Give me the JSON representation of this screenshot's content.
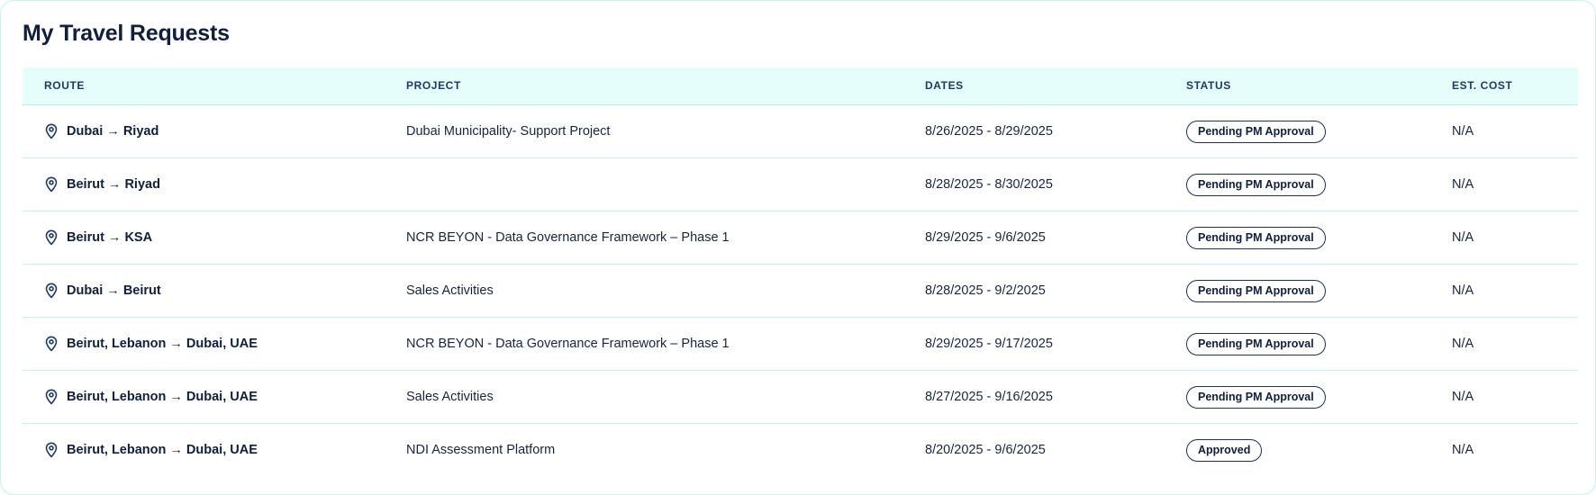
{
  "page": {
    "title": "My Travel Requests"
  },
  "table": {
    "headers": {
      "route": "ROUTE",
      "project": "PROJECT",
      "dates": "DATES",
      "status": "STATUS",
      "cost": "EST. COST"
    },
    "rows": [
      {
        "route": "Dubai → Riyad",
        "project": "Dubai Municipality- Support Project",
        "dates": "8/26/2025 - 8/29/2025",
        "status": "Pending PM Approval",
        "cost": "N/A"
      },
      {
        "route": "Beirut → Riyad",
        "project": "",
        "dates": "8/28/2025 - 8/30/2025",
        "status": "Pending PM Approval",
        "cost": "N/A"
      },
      {
        "route": "Beirut → KSA",
        "project": "NCR BEYON - Data Governance Framework – Phase 1",
        "dates": "8/29/2025 - 9/6/2025",
        "status": "Pending PM Approval",
        "cost": "N/A"
      },
      {
        "route": "Dubai → Beirut",
        "project": "Sales Activities",
        "dates": "8/28/2025 - 9/2/2025",
        "status": "Pending PM Approval",
        "cost": "N/A"
      },
      {
        "route": "Beirut, Lebanon → Dubai, UAE",
        "project": "NCR BEYON - Data Governance Framework – Phase 1",
        "dates": "8/29/2025 - 9/17/2025",
        "status": "Pending PM Approval",
        "cost": "N/A"
      },
      {
        "route": "Beirut, Lebanon → Dubai, UAE",
        "project": "Sales Activities",
        "dates": "8/27/2025 - 9/16/2025",
        "status": "Pending PM Approval",
        "cost": "N/A"
      },
      {
        "route": "Beirut, Lebanon → Dubai, UAE",
        "project": "NDI Assessment Platform",
        "dates": "8/20/2025 - 9/6/2025",
        "status": "Approved",
        "cost": "N/A"
      }
    ]
  },
  "icons": {
    "route": "map-pin-icon"
  },
  "colors": {
    "header_bg": "#e5fdfb",
    "row_divider": "#c2f1ee",
    "text_primary": "#0f1f3d",
    "badge_border": "#1c2f5a"
  }
}
